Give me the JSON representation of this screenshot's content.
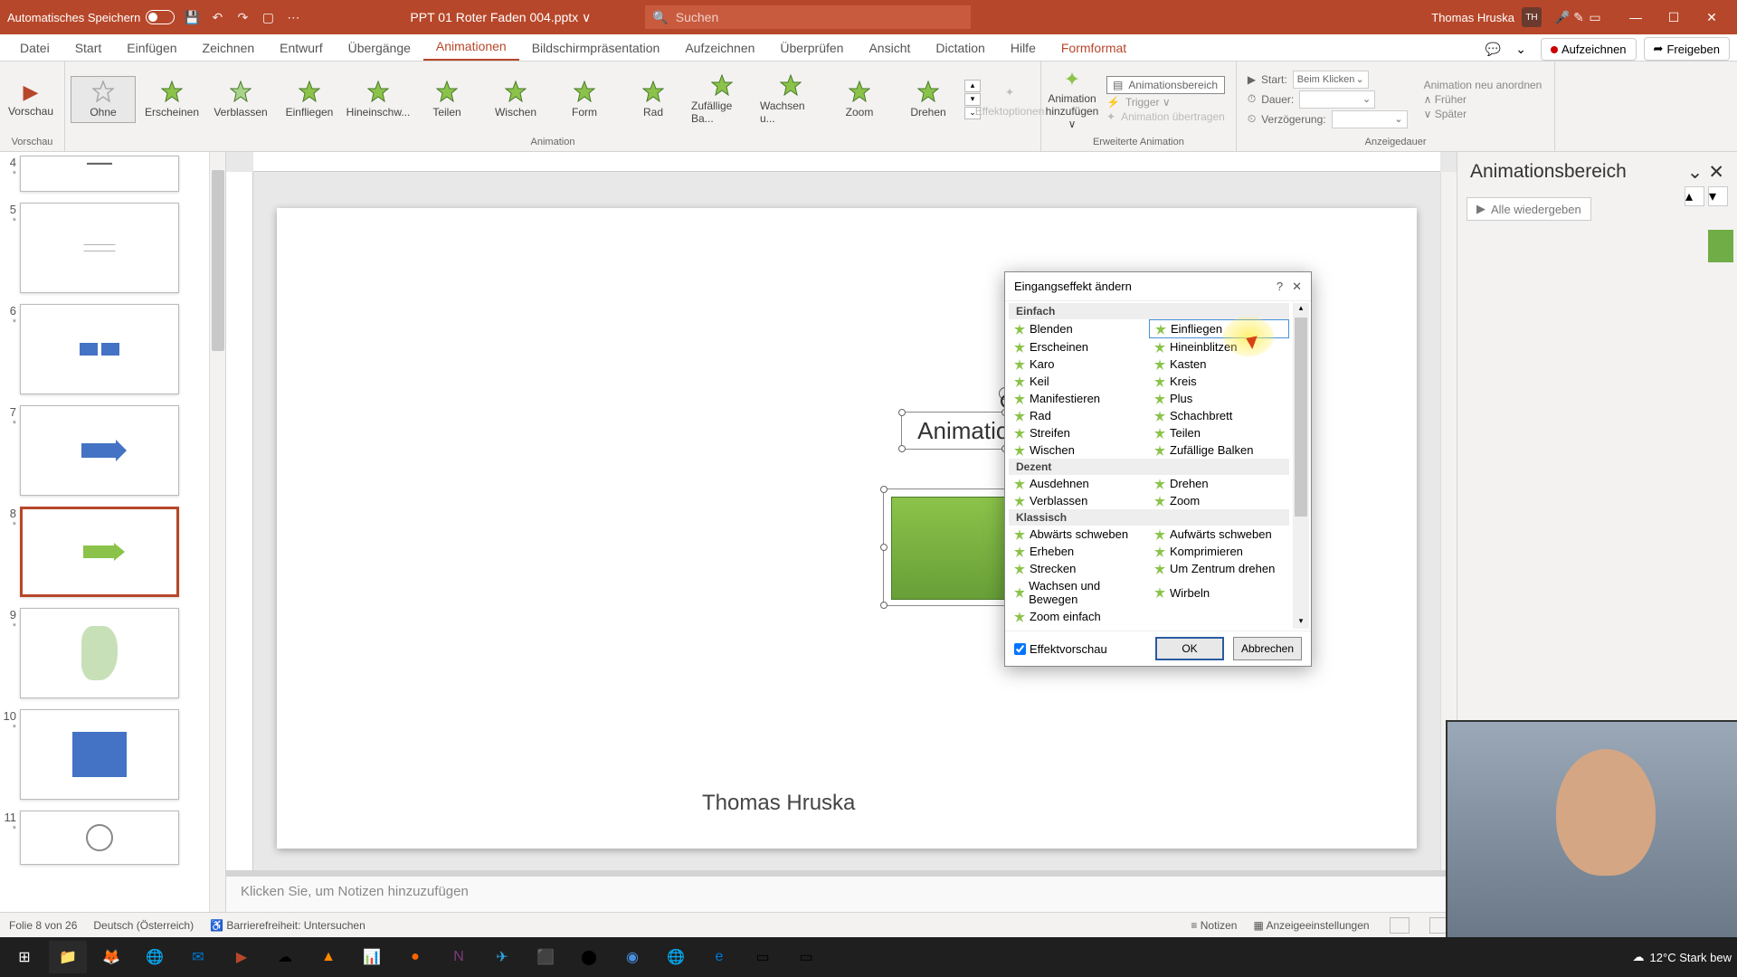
{
  "titlebar": {
    "autosave": "Automatisches Speichern",
    "filename": "PPT 01 Roter Faden 004.pptx ∨",
    "search_placeholder": "Suchen",
    "user": "Thomas Hruska",
    "user_initials": "TH"
  },
  "tabs": {
    "datei": "Datei",
    "start": "Start",
    "einfuegen": "Einfügen",
    "zeichnen": "Zeichnen",
    "entwurf": "Entwurf",
    "uebergaenge": "Übergänge",
    "animationen": "Animationen",
    "bildschirm": "Bildschirmpräsentation",
    "aufzeichnen": "Aufzeichnen",
    "ueberpruefen": "Überprüfen",
    "ansicht": "Ansicht",
    "dictation": "Dictation",
    "hilfe": "Hilfe",
    "formformat": "Formformat",
    "btn_aufzeichnen": "Aufzeichnen",
    "btn_freigeben": "Freigeben"
  },
  "ribbon": {
    "vorschau": "Vorschau",
    "group_anim": "Animation",
    "group_erw": "Erweiterte Animation",
    "group_dauer": "Anzeigedauer",
    "none": "Ohne",
    "erscheinen": "Erscheinen",
    "verblassen": "Verblassen",
    "einfliegen": "Einfliegen",
    "hineinschw": "Hineinschw...",
    "teilen": "Teilen",
    "wischen": "Wischen",
    "form": "Form",
    "rad": "Rad",
    "zufall": "Zufällige Ba...",
    "wachsen": "Wachsen u...",
    "zoom": "Zoom",
    "drehen": "Drehen",
    "effektopt": "Effektoptionen",
    "anim_add": "Animation hinzufügen ∨",
    "anim_bereich": "Animationsbereich",
    "trigger": "Trigger ∨",
    "anim_uebertragen": "Animation übertragen",
    "start_lbl": "Start:",
    "start_val": "Beim Klicken",
    "dauer_lbl": "Dauer:",
    "verz_lbl": "Verzögerung:",
    "reorder_title": "Animation neu anordnen",
    "frueher": "Früher",
    "spaeter": "Später"
  },
  "pane": {
    "title": "Animationsbereich",
    "play": "Alle wiedergeben"
  },
  "slide": {
    "title": "Animation testen",
    "author": "Thomas Hruska"
  },
  "notes": {
    "placeholder": "Klicken Sie, um Notizen hinzuzufügen"
  },
  "dialog": {
    "title": "Eingangseffekt ändern",
    "cat1": "Einfach",
    "blenden": "Blenden",
    "einfliegen": "Einfliegen",
    "erscheinen": "Erscheinen",
    "hineinblitzen": "Hineinblitzen",
    "karo": "Karo",
    "kasten": "Kasten",
    "keil": "Keil",
    "kreis": "Kreis",
    "manifest": "Manifestieren",
    "plus": "Plus",
    "rad": "Rad",
    "schachbrett": "Schachbrett",
    "streifen": "Streifen",
    "teilen": "Teilen",
    "wischen": "Wischen",
    "zufbalken": "Zufällige Balken",
    "cat2": "Dezent",
    "ausdehnen": "Ausdehnen",
    "drehen": "Drehen",
    "verblassen": "Verblassen",
    "zoom": "Zoom",
    "cat3": "Klassisch",
    "abw": "Abwärts schweben",
    "aufw": "Aufwärts schweben",
    "erheben": "Erheben",
    "kompr": "Komprimieren",
    "strecken": "Strecken",
    "umzentrum": "Um Zentrum drehen",
    "wachsbew": "Wachsen und Bewegen",
    "wirbeln": "Wirbeln",
    "zoomeinfach": "Zoom einfach",
    "effektvorschau": "Effektvorschau",
    "ok": "OK",
    "cancel": "Abbrechen"
  },
  "thumbs": {
    "n4": "4",
    "n5": "5",
    "n6": "6",
    "n7": "7",
    "n8": "8",
    "n9": "9",
    "n10": "10",
    "n11": "11"
  },
  "status": {
    "folie": "Folie 8 von 26",
    "lang": "Deutsch (Österreich)",
    "barriere": "Barrierefreiheit: Untersuchen",
    "notizen": "Notizen",
    "anzeige": "Anzeigeeinstellungen"
  },
  "taskbar": {
    "weather": "12°C  Stark bew"
  }
}
